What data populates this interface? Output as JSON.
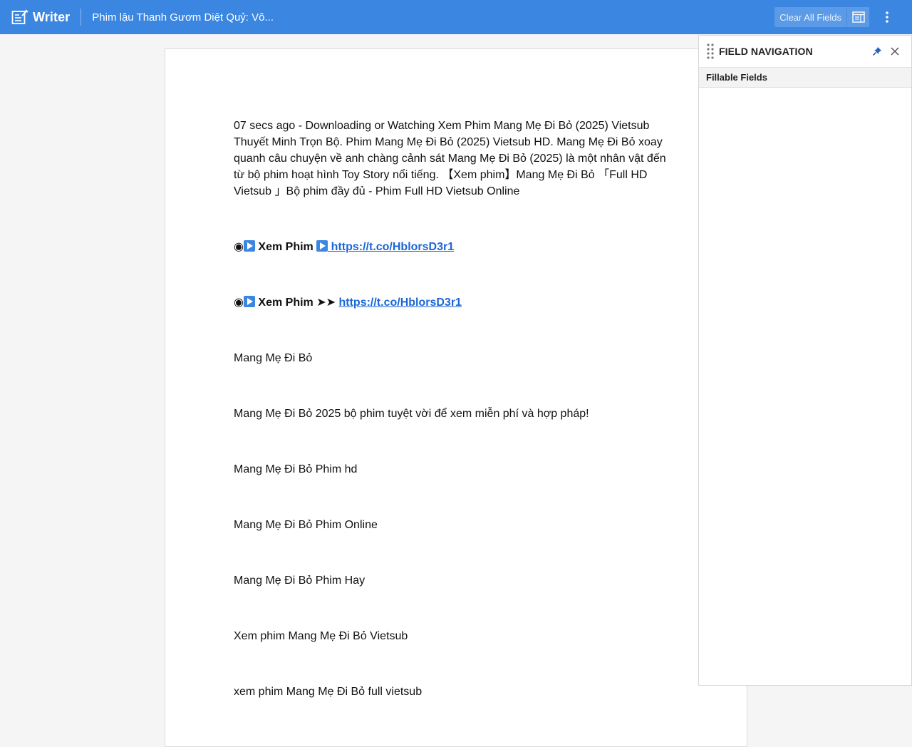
{
  "app": {
    "name": "Writer",
    "doc_title": "Phim lậu Thanh Gươm Diệt Quỷ: Vô..."
  },
  "toolbar": {
    "clear_all_label": "Clear All Fields"
  },
  "document": {
    "intro": "07 secs ago - Downloading or Watching Xem Phim Mang Mẹ Đi Bỏ (2025) Vietsub Thuyết Minh Trọn Bộ. Phim Mang Mẹ Đi Bỏ (2025) Vietsub HD. Mang Mẹ Đi Bỏ xoay quanh câu chuyện về anh chàng cảnh sát Mang Mẹ Đi Bỏ (2025) là một nhân vật đến từ bộ phim hoạt hình Toy Story nổi tiếng. 【Xem phim】Mang Mẹ Đi Bỏ 「Full HD Vietsub 」Bộ phim đầy đủ - Phim Full HD Vietsub Online",
    "link_line_1": {
      "bullet": "◉",
      "label": " Xem Phim ",
      "url": " https://t.co/HblorsD3r1"
    },
    "link_line_2": {
      "bullet": "◉",
      "label": " Xem Phim ➤➤ ",
      "url": "https://t.co/HblorsD3r1"
    },
    "lines": [
      "Mang Mẹ Đi Bỏ",
      "Mang Mẹ Đi Bỏ 2025 bộ phim tuyệt vời để xem miễn phí và hợp pháp!",
      "Mang Mẹ Đi Bỏ Phim hd",
      "Mang Mẹ Đi Bỏ Phim Online",
      "Mang Mẹ Đi Bỏ Phim Hay",
      "Xem phim Mang Mẹ Đi Bỏ Vietsub",
      "xem phim Mang Mẹ Đi Bỏ full vietsub"
    ]
  },
  "panel": {
    "title": "FIELD NAVIGATION",
    "section": "Fillable Fields"
  },
  "colors": {
    "topbar": "#3a86e0",
    "link": "#1a66d6"
  },
  "icons": {
    "brand": "writer-doc-icon",
    "field_toggle": "field-panel-icon",
    "more": "vertical-dots-icon",
    "pin": "pin-icon",
    "close": "close-icon",
    "drag": "drag-handle-icon",
    "play": "play-button-icon"
  }
}
